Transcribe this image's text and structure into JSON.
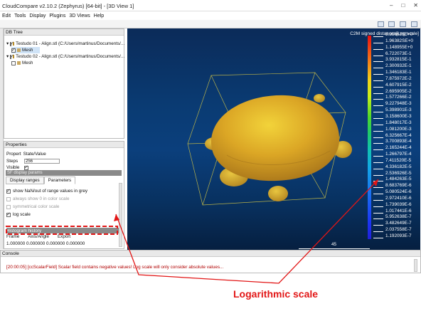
{
  "window": {
    "title": "CloudCompare v2.10.2 (Zephyrus) [64-bit] - [3D View 1]"
  },
  "menu": {
    "items": [
      "Edit",
      "Tools",
      "Display",
      "Plugins",
      "3D Views",
      "Help"
    ]
  },
  "db_tree": {
    "header": "DB Tree",
    "items": [
      {
        "label": "Testudo 01 - Align.stl (C:/Users/martinus/Documents/...",
        "checked": true,
        "selected": false
      },
      {
        "label": "Mesh",
        "checked": true,
        "selected": true
      },
      {
        "label": "Testudo 02 - Align.stl (C:/Users/martinus/Documents/...",
        "checked": true,
        "selected": false
      },
      {
        "label": "Mesh",
        "checked": false,
        "selected": false
      }
    ]
  },
  "properties": {
    "header": "Properties",
    "col_property": "Propert",
    "col_value": "State/Value",
    "steps_label": "Steps",
    "steps_value": "256",
    "visible_label": "Visible",
    "sf_params": "SF display params",
    "tab_display_ranges": "Display ranges",
    "tab_parameters": "Parameters",
    "show_nan": "show NaN/out of range values in grey",
    "always_show_zero": "always show 0 in color scale",
    "symmetrical": "symmetrical color scale",
    "log_scale": "log scale",
    "histogram": "Histogram history",
    "col_frame": "Frame",
    "col_axis_angle": "Axis/Angle",
    "col_export": "Export",
    "matrix_row": "1.000000 0.000000 0.000000 0.000000"
  },
  "view3d": {
    "legend_title": "C2M signed distances[Log scale]",
    "legend_labels": [
      "3.356623E+0",
      "1.96382SE+0",
      "1.148955E+0",
      "6.722073E-1",
      "3.932815E-1",
      "2.300932E-1",
      "1.346183E-1",
      "7.875972E-2",
      "4.607915E-2",
      "2.695905E-2",
      "1.577266E-2",
      "9.227948E-3",
      "5.398901E-3",
      "3.158600E-3",
      "1.848017E-3",
      "1.081200E-3",
      "6.325667E-4",
      "3.700893E-4",
      "2.165244E-4",
      "1.266797E-4",
      "7.411520E-5",
      "4.336182E-5",
      "2.536926E-5",
      "1.484263E-5",
      "8.683769E-6",
      "5.080524E-6",
      "2.972410E-6",
      "1.739039E-6",
      "1.017441E-6",
      "5.952638E-7",
      "3.482649E-7",
      "2.037558E-7",
      "1.192093E-7"
    ],
    "scale_value": "45",
    "colors": {
      "background_top": "#0b2b59",
      "background_bottom": "#061f40",
      "bbox": "#b8b24a",
      "turtle": "#d4a22a"
    }
  },
  "console": {
    "header": "Console",
    "message": "[20:00:05] [ccScalarField] Scalar field contains negative values! Log scale will only consider absolute values..."
  },
  "annotation": {
    "label": "Logarithmic scale",
    "color": "#e21616"
  }
}
